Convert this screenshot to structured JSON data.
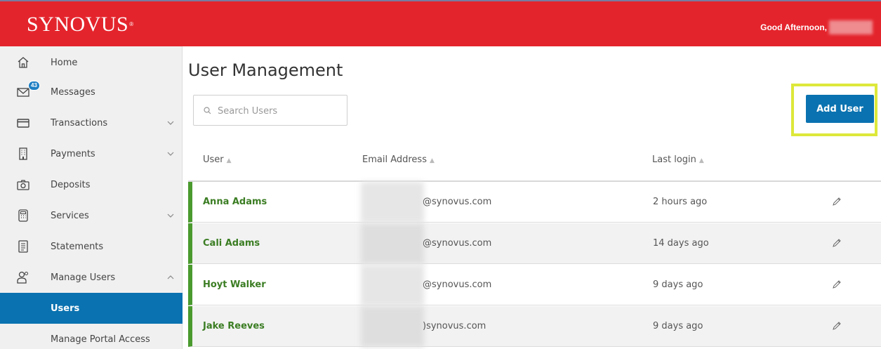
{
  "header": {
    "brand": "SYNOVUS",
    "greeting": "Good Afternoon,",
    "brand_color": "#e4242c"
  },
  "sidebar": {
    "items": [
      {
        "label": "Home",
        "icon": "home-icon"
      },
      {
        "label": "Messages",
        "icon": "mail-icon",
        "badge": "43"
      },
      {
        "label": "Transactions",
        "icon": "credit-card-icon",
        "expandable": true
      },
      {
        "label": "Payments",
        "icon": "building-icon",
        "expandable": true
      },
      {
        "label": "Deposits",
        "icon": "camera-icon"
      },
      {
        "label": "Services",
        "icon": "calculator-icon",
        "expandable": true
      },
      {
        "label": "Statements",
        "icon": "document-icon"
      },
      {
        "label": "Manage Users",
        "icon": "users-icon",
        "expanded": true
      }
    ],
    "subitems": [
      {
        "label": "Users",
        "active": true
      },
      {
        "label": "Manage Portal Access",
        "active": false
      }
    ]
  },
  "main": {
    "title": "User Management",
    "search_placeholder": "Search Users",
    "add_button": "Add User",
    "columns": [
      "User",
      "Email Address",
      "Last login"
    ],
    "rows": [
      {
        "name": "Anna Adams",
        "email": "@synovus.com",
        "last_login": "2 hours ago"
      },
      {
        "name": "Cali Adams",
        "email": "@synovus.com",
        "last_login": "14 days ago"
      },
      {
        "name": "Hoyt Walker",
        "email": "@synovus.com",
        "last_login": "9 days ago"
      },
      {
        "name": "Jake Reeves",
        "email": ")synovus.com",
        "last_login": "9 days ago"
      }
    ],
    "accent_color": "#0a72b0",
    "name_color": "#3b7d23"
  }
}
